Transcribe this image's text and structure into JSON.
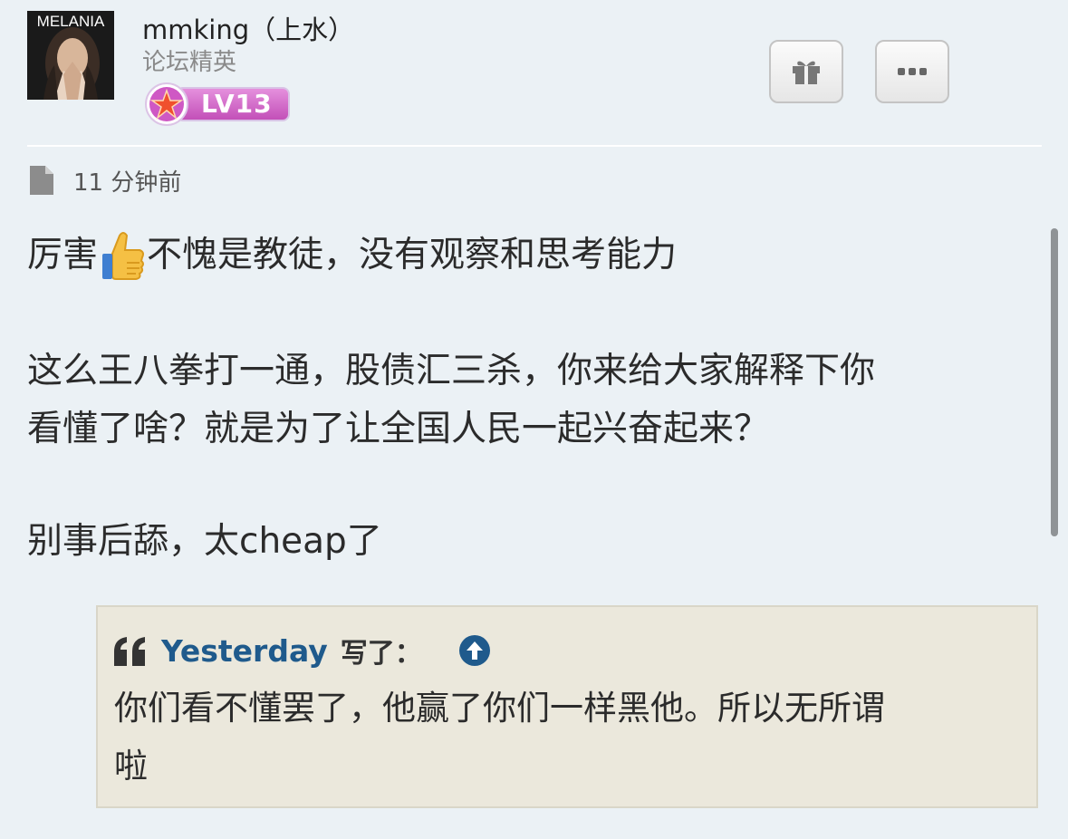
{
  "user": {
    "avatar_logo": "MELANIA",
    "name": "mmking（上水）",
    "rank": "论坛精英",
    "level": "LV13"
  },
  "actions": {
    "gift_icon": "gift-icon",
    "more_icon": "more-icon"
  },
  "post": {
    "time_icon": "document-icon",
    "time": "11 分钟前",
    "line1_before": "厉害",
    "line1_emoji": "thumbs-up-icon",
    "line1_after": "不愧是教徒，没有观察和思考能力",
    "para2_line1": "这么王八拳打一通，股债汇三杀，你来给大家解释下你",
    "para2_line2": "看懂了啥？就是为了让全国人民一起兴奋起来？",
    "para3": "别事后舔，太cheap了"
  },
  "quote": {
    "icon": "quote-icon",
    "author": "Yesterday",
    "wrote": "写了：",
    "up_icon": "arrow-up-circle-icon",
    "line1": "你们看不懂罢了，他赢了你们一样黑他。所以无所谓",
    "line2": "啦"
  },
  "colors": {
    "background": "#ebf1f5",
    "link": "#1f5a8c",
    "level_badge": "#c94fbf",
    "quote_bg": "#ebe8dc"
  }
}
